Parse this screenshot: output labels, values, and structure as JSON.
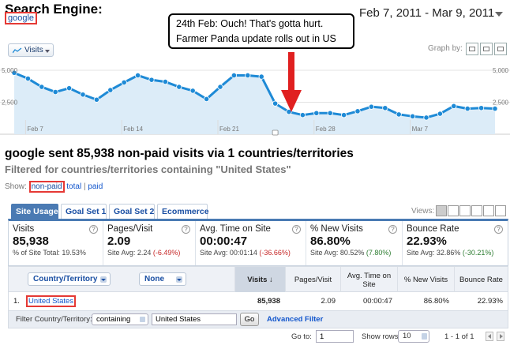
{
  "header": {
    "title": "Search Engine:",
    "engine": "google",
    "date_range": "Feb 7, 2011 - Mar 9, 2011"
  },
  "callout": {
    "line1": "24th Feb: Ouch! That's gotta hurt.",
    "line2": "Farmer Panda update rolls out in US"
  },
  "graph": {
    "metric_label": "Visits",
    "graph_by_label": "Graph by:"
  },
  "chart_data": {
    "type": "area",
    "series": [
      {
        "name": "Visits",
        "values": [
          4800,
          4350,
          3700,
          3300,
          3600,
          3100,
          2700,
          3450,
          4050,
          4600,
          4250,
          4100,
          3700,
          3400,
          2750,
          3700,
          4600,
          4600,
          4500,
          2400,
          1750,
          1500,
          1650,
          1650,
          1500,
          1800,
          2150,
          2050,
          1550,
          1400,
          1300,
          1600,
          2200,
          2000,
          2050,
          2000
        ]
      }
    ],
    "x_tick_labels": [
      "Feb 7",
      "Feb 14",
      "Feb 21",
      "Feb 28",
      "Mar 7"
    ],
    "y_tick_labels": [
      "5,000",
      "2,500"
    ],
    "ylim": [
      0,
      5000
    ],
    "color": "#1e8ad6",
    "fill_color": "#dcecf8"
  },
  "summary": {
    "title": "google sent 85,938 non-paid visits via 1 countries/territories",
    "subtitle": "Filtered for countries/territories containing \"United States\"",
    "show_label": "Show:",
    "show_selected": "non-paid",
    "show_total": "total",
    "sep": "|",
    "show_paid": "paid"
  },
  "tabs": [
    "Site Usage",
    "Goal Set 1",
    "Goal Set 2",
    "Ecommerce"
  ],
  "views_label": "Views:",
  "scorecard": [
    {
      "label": "Visits",
      "value": "85,938",
      "sub_prefix": "% of Site Total: ",
      "sub_value": "19.53%",
      "sub_extra": ""
    },
    {
      "label": "Pages/Visit",
      "value": "2.09",
      "sub_prefix": "Site Avg: 2.24 ",
      "sub_value": "(-6.49%)",
      "sub_extra": "neg"
    },
    {
      "label": "Avg. Time on Site",
      "value": "00:00:47",
      "sub_prefix": "Site Avg: 00:01:14 ",
      "sub_value": "(-36.66%)",
      "sub_extra": "neg"
    },
    {
      "label": "% New Visits",
      "value": "86.80%",
      "sub_prefix": "Site Avg: 80.52% ",
      "sub_value": "(7.80%)",
      "sub_extra": "pos"
    },
    {
      "label": "Bounce Rate",
      "value": "22.93%",
      "sub_prefix": "Site Avg: 32.86% ",
      "sub_value": "(-30.21%)",
      "sub_extra": "pos"
    }
  ],
  "table": {
    "dimension": "Country/Territory",
    "secondary": "None",
    "columns": [
      "Visits",
      "Pages/Visit",
      "Avg. Time on Site",
      "% New Visits",
      "Bounce Rate"
    ],
    "rows": [
      {
        "index": "1.",
        "name": "United States",
        "cells": [
          "85,938",
          "2.09",
          "00:00:47",
          "86.80%",
          "22.93%"
        ]
      }
    ]
  },
  "filter": {
    "label": "Filter Country/Territory:",
    "mode": "containing",
    "value": "United States",
    "go": "Go",
    "advanced": "Advanced Filter"
  },
  "pager": {
    "goto_label": "Go to:",
    "goto_value": "1",
    "rows_label": "Show rows:",
    "rows_value": "10",
    "range": "1 - 1 of 1"
  }
}
